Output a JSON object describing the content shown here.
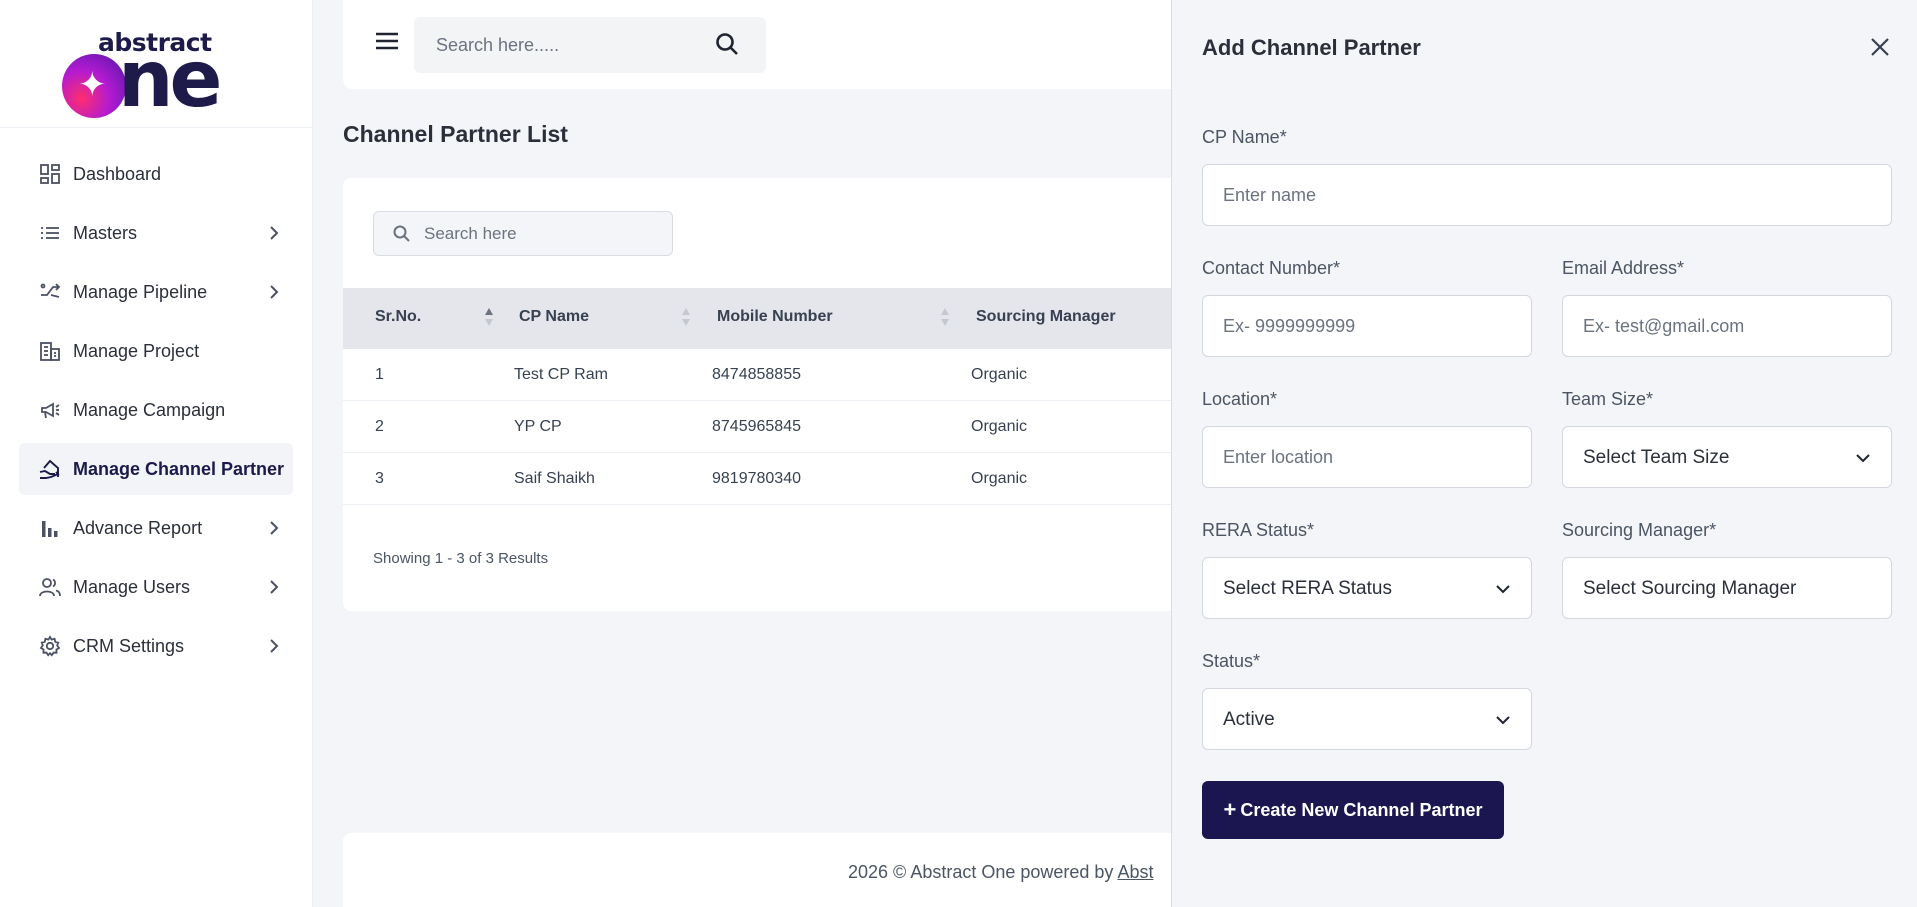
{
  "brand": {
    "top_word": "abstract",
    "big_word": "ne"
  },
  "sidebar": {
    "items": [
      {
        "label": "Dashboard",
        "icon": "dashboard-icon",
        "has_submenu": false,
        "active": false
      },
      {
        "label": "Masters",
        "icon": "list-icon",
        "has_submenu": true,
        "active": false
      },
      {
        "label": "Manage Pipeline",
        "icon": "pipeline-icon",
        "has_submenu": true,
        "active": false
      },
      {
        "label": "Manage Project",
        "icon": "building-icon",
        "has_submenu": false,
        "active": false
      },
      {
        "label": "Manage Campaign",
        "icon": "megaphone-icon",
        "has_submenu": false,
        "active": false
      },
      {
        "label": "Manage Channel Partner",
        "icon": "handshake-home-icon",
        "has_submenu": false,
        "active": true
      },
      {
        "label": "Advance Report",
        "icon": "bar-chart-icon",
        "has_submenu": true,
        "active": false
      },
      {
        "label": "Manage Users",
        "icon": "users-icon",
        "has_submenu": true,
        "active": false
      },
      {
        "label": "CRM Settings",
        "icon": "gear-icon",
        "has_submenu": true,
        "active": false
      }
    ]
  },
  "topbar": {
    "search_placeholder": "Search here....."
  },
  "page": {
    "title": "Channel Partner List",
    "table_search_placeholder": "Search here",
    "columns": [
      "Sr.No.",
      "CP Name",
      "Mobile Number",
      "Sourcing Manager"
    ],
    "rows": [
      [
        "1",
        "Test CP Ram",
        "8474858855",
        "Organic"
      ],
      [
        "2",
        "YP CP",
        "8745965845",
        "Organic"
      ],
      [
        "3",
        "Saif Shaikh",
        "9819780340",
        "Organic"
      ]
    ],
    "showing": "Showing 1 - 3 of 3 Results"
  },
  "footer": {
    "text": "2026 © Abstract One powered by ",
    "link": "Abst"
  },
  "drawer": {
    "title": "Add Channel Partner",
    "fields": {
      "cp_name": {
        "label": "CP Name*",
        "placeholder": "Enter name"
      },
      "contact": {
        "label": "Contact Number*",
        "placeholder": "Ex- 9999999999"
      },
      "email": {
        "label": "Email Address*",
        "placeholder": "Ex- test@gmail.com"
      },
      "location": {
        "label": "Location*",
        "placeholder": "Enter location"
      },
      "team_size": {
        "label": "Team Size*",
        "value": "Select Team Size"
      },
      "rera": {
        "label": "RERA Status*",
        "value": "Select RERA Status"
      },
      "sourcing": {
        "label": "Sourcing Manager*",
        "value": "Select Sourcing Manager"
      },
      "status": {
        "label": "Status*",
        "value": "Active"
      }
    },
    "submit_label": "Create New Channel Partner",
    "submit_prefix": "+"
  },
  "colors": {
    "primary": "#1b1650",
    "background": "#f4f5f8",
    "table_header": "#e4e6ec"
  }
}
